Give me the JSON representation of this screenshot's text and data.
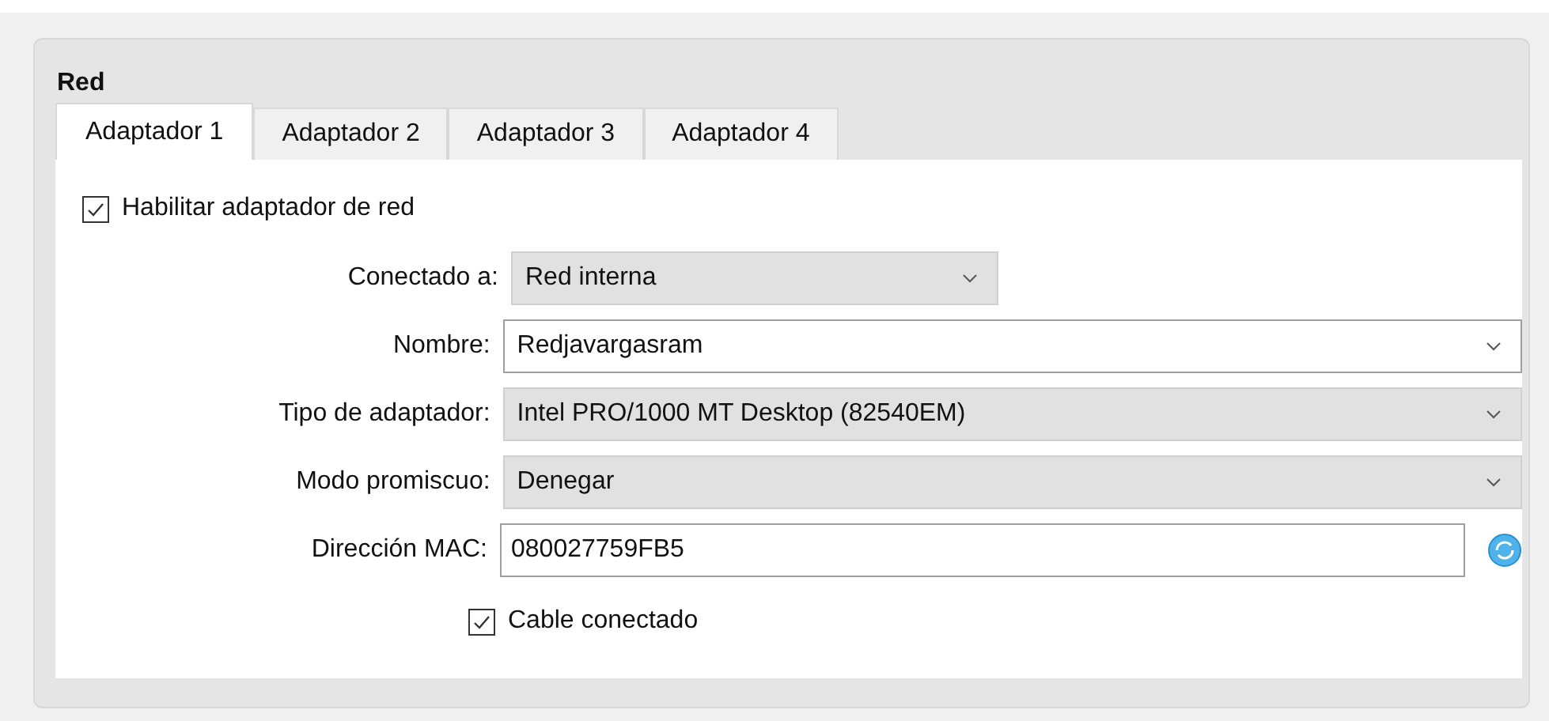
{
  "group": {
    "title": "Red"
  },
  "tabs": [
    {
      "label": "Adaptador 1",
      "selected": true
    },
    {
      "label": "Adaptador 2",
      "selected": false
    },
    {
      "label": "Adaptador 3",
      "selected": false
    },
    {
      "label": "Adaptador 4",
      "selected": false
    }
  ],
  "enable": {
    "label": "Habilitar adaptador de red",
    "checked": true
  },
  "fields": [
    {
      "kind": "short-select",
      "label": "Conectado a:",
      "value": "Red interna"
    },
    {
      "kind": "combo",
      "label": "Nombre:",
      "value": "Redjavargasram"
    },
    {
      "kind": "select",
      "label": "Tipo de adaptador:",
      "value": "Intel PRO/1000 MT Desktop (82540EM)"
    },
    {
      "kind": "select",
      "label": "Modo promiscuo:",
      "value": "Denegar"
    },
    {
      "kind": "text",
      "label": "Dirección MAC:",
      "value": "080027759FB5"
    }
  ],
  "cable": {
    "label": "Cable conectado",
    "checked": true
  }
}
